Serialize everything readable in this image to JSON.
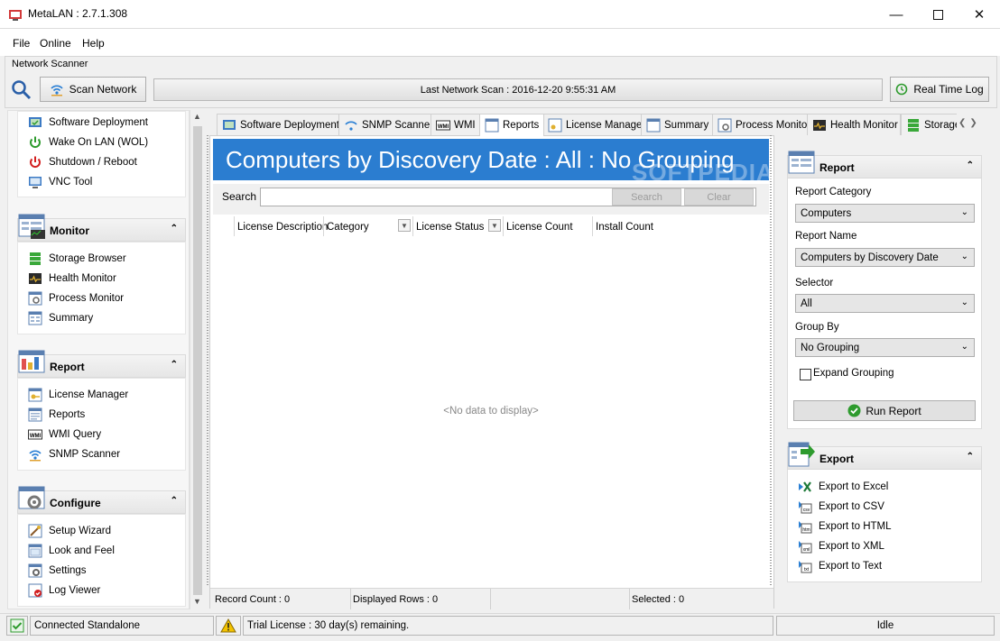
{
  "window": {
    "title": "MetaLAN : 2.7.1.308"
  },
  "menu": [
    "File",
    "Online",
    "Help"
  ],
  "scanner": {
    "group_label": "Network Scanner",
    "scan_button": "Scan Network",
    "last_scan": "Last Network Scan : 2016-12-20 9:55:31 AM",
    "realtime_button": "Real Time Log"
  },
  "nav": {
    "tools": [
      {
        "label": "Software Deployment",
        "icon": "software-deployment-icon"
      },
      {
        "label": "Wake On LAN (WOL)",
        "icon": "power-icon"
      },
      {
        "label": "Shutdown / Reboot",
        "icon": "restart-icon"
      },
      {
        "label": "VNC Tool",
        "icon": "monitor-icon"
      }
    ],
    "monitor": {
      "title": "Monitor",
      "items": [
        "Storage Browser",
        "Health Monitor",
        "Process Monitor",
        "Summary"
      ]
    },
    "report": {
      "title": "Report",
      "items": [
        "License Manager",
        "Reports",
        "WMI Query",
        "SNMP Scanner"
      ]
    },
    "configure": {
      "title": "Configure",
      "items": [
        "Setup Wizard",
        "Look and Feel",
        "Settings",
        "Log Viewer"
      ]
    }
  },
  "tabs": [
    "Software Deployment",
    "SNMP Scanner",
    "WMI",
    "Reports",
    "License Manager",
    "Summary",
    "Process Monitor",
    "Health Monitor",
    "Storage"
  ],
  "active_tab": "Reports",
  "report_view": {
    "banner": "Computers by Discovery Date : All  : No Grouping",
    "search_label": "Search",
    "search_button": "Search",
    "clear_button": "Clear",
    "columns": [
      "License Description",
      "Category",
      "License Status",
      "License Count",
      "Install Count"
    ],
    "empty_text": "<No data to display>",
    "watermark": "SOFTPEDIA"
  },
  "footer": {
    "record_count": "Record Count : 0",
    "displayed_rows": "Displayed Rows : 0",
    "selected": "Selected : 0"
  },
  "report_panel": {
    "title": "Report",
    "category_label": "Report Category",
    "category_value": "Computers",
    "name_label": "Report Name",
    "name_value": "Computers by Discovery Date",
    "selector_label": "Selector",
    "selector_value": "All",
    "groupby_label": "Group By",
    "groupby_value": "No Grouping",
    "expand_label": "Expand Grouping",
    "run_button": "Run Report"
  },
  "export_panel": {
    "title": "Export",
    "items": [
      "Export to Excel",
      "Export to CSV",
      "Export to HTML",
      "Export to XML",
      "Export to Text"
    ]
  },
  "status": {
    "connection": "Connected Standalone",
    "license": "Trial License : 30 day(s) remaining.",
    "state": "Idle"
  },
  "colors": {
    "accent": "#2b7dd0",
    "ok_green": "#2e9b2e"
  }
}
